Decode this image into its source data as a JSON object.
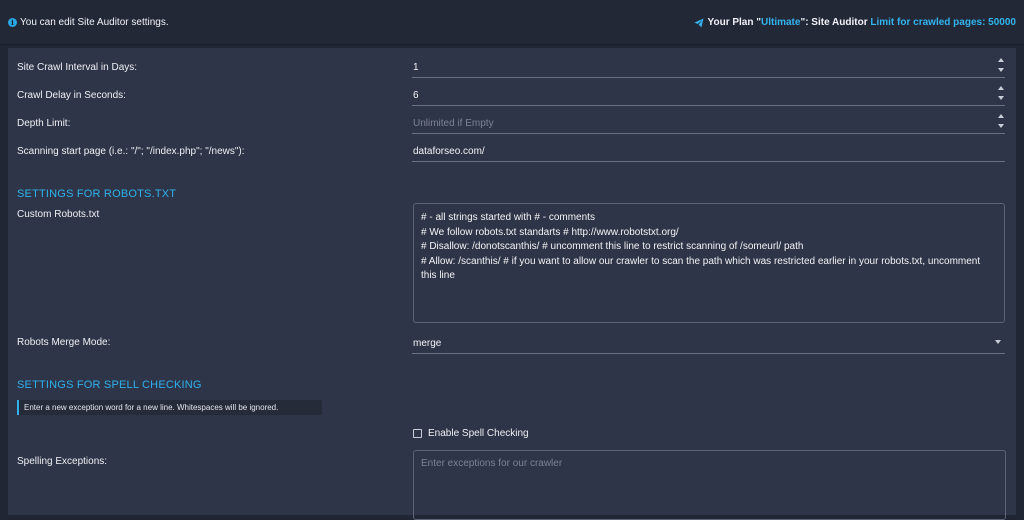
{
  "header": {
    "info_icon": "info-circle-icon",
    "info_text": "You can edit Site Auditor settings.",
    "plan_icon": "paper-plane-icon",
    "plan_prefix": "Your Plan \"",
    "plan_name": "Ultimate",
    "plan_suffix": "\": Site Auditor ",
    "plan_limit": "Limit for crawled pages: 50000",
    "accent_color": "#32b4ee"
  },
  "form": {
    "crawl_interval": {
      "label": "Site Crawl Interval in Days:",
      "value": "1"
    },
    "crawl_delay": {
      "label": "Crawl Delay in Seconds:",
      "value": "6"
    },
    "depth_limit": {
      "label": "Depth Limit:",
      "placeholder": "Unlimited if Empty"
    },
    "start_page": {
      "label": "Scanning start page (i.e.: \"/\"; \"/index.php\"; \"/news\"):",
      "value": "dataforseo.com/"
    }
  },
  "robots": {
    "section_title": "SETTINGS FOR ROBOTS.TXT",
    "custom_label": "Custom Robots.txt",
    "lines": [
      "# - all strings started with # - comments",
      "# We follow robots.txt standarts # http://www.robotstxt.org/",
      "# Disallow: /donotscanthis/ # uncomment this line to restrict scanning of /someurl/ path",
      "# Allow: /scanthis/ # if you want to allow our crawler to scan the path which was restricted earlier in your robots.txt, uncomment this line"
    ],
    "merge_label": "Robots Merge Mode:",
    "merge_value": "merge"
  },
  "spell": {
    "section_title": "SETTINGS FOR SPELL CHECKING",
    "hint": "Enter a new exception word for a new line. Whitespaces will be ignored.",
    "enable_label": "Enable Spell Checking",
    "enabled": false,
    "exceptions_label": "Spelling Exceptions:",
    "exceptions_placeholder": "Enter exceptions for our crawler"
  }
}
